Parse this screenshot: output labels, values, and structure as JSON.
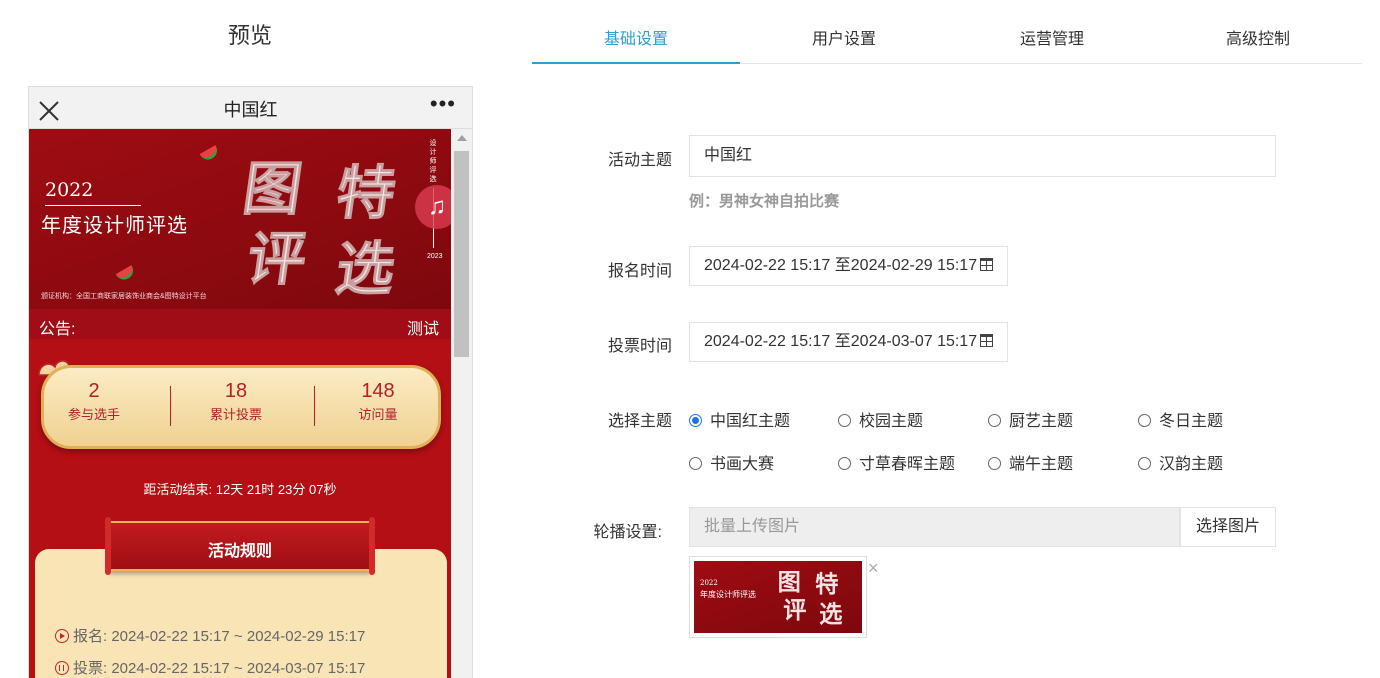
{
  "preview": {
    "heading": "预览",
    "phone_title": "中国红",
    "more": "•••",
    "banner": {
      "year": "2022",
      "subtitle": "年度设计师评选",
      "big_chars": [
        "图",
        "特",
        "评",
        "选"
      ],
      "vertical_text": "设计师评选",
      "vertical_year": "2023",
      "org": "颁证机构：全国工商联家居装饰业商会&图特设计平台"
    },
    "music_icon": "♫",
    "notice": {
      "label": "公告:",
      "text": "测试"
    },
    "stats": [
      {
        "value": "2",
        "label": "参与选手"
      },
      {
        "value": "18",
        "label": "累计投票"
      },
      {
        "value": "148",
        "label": "访问量"
      }
    ],
    "countdown": "距活动结束:  12天 21时 23分 07秒",
    "rules_title": "活动规则",
    "rules": [
      {
        "icon": "play-circle-icon",
        "text": "报名: 2024-02-22 15:17 ~ 2024-02-29 15:17"
      },
      {
        "icon": "pause-circle-icon",
        "text": "投票: 2024-02-22 15:17 ~ 2024-03-07 15:17"
      }
    ]
  },
  "tabs": [
    {
      "label": "基础设置",
      "active": true
    },
    {
      "label": "用户设置",
      "active": false
    },
    {
      "label": "运营管理",
      "active": false
    },
    {
      "label": "高级控制",
      "active": false
    }
  ],
  "form": {
    "theme_label": "活动主题",
    "theme_value": "中国红",
    "theme_hint": "例：男神女神自拍比赛",
    "signup_label": "报名时间",
    "signup_value": "2024-02-22 15:17 至2024-02-29 15:17",
    "vote_label": "投票时间",
    "vote_value": "2024-02-22 15:17 至2024-03-07 15:17",
    "style_label": "选择主题",
    "styles": [
      {
        "label": "中国红主题",
        "checked": true
      },
      {
        "label": "校园主题",
        "checked": false
      },
      {
        "label": "厨艺主题",
        "checked": false
      },
      {
        "label": "冬日主题",
        "checked": false
      },
      {
        "label": "书画大赛",
        "checked": false
      },
      {
        "label": "寸草春晖主题",
        "checked": false
      },
      {
        "label": "端午主题",
        "checked": false
      },
      {
        "label": "汉韵主题",
        "checked": false
      }
    ],
    "carousel_label": "轮播设置:",
    "upload_placeholder": "批量上传图片",
    "upload_button": "选择图片",
    "thumb": {
      "year": "2022",
      "subtitle": "年度设计师评选",
      "remove": "×"
    }
  },
  "colors": {
    "accent": "#2b9fd0",
    "banner_red": "#9e0c12",
    "radio_blue": "#1a73e8",
    "gold": "#f9e4b6"
  }
}
